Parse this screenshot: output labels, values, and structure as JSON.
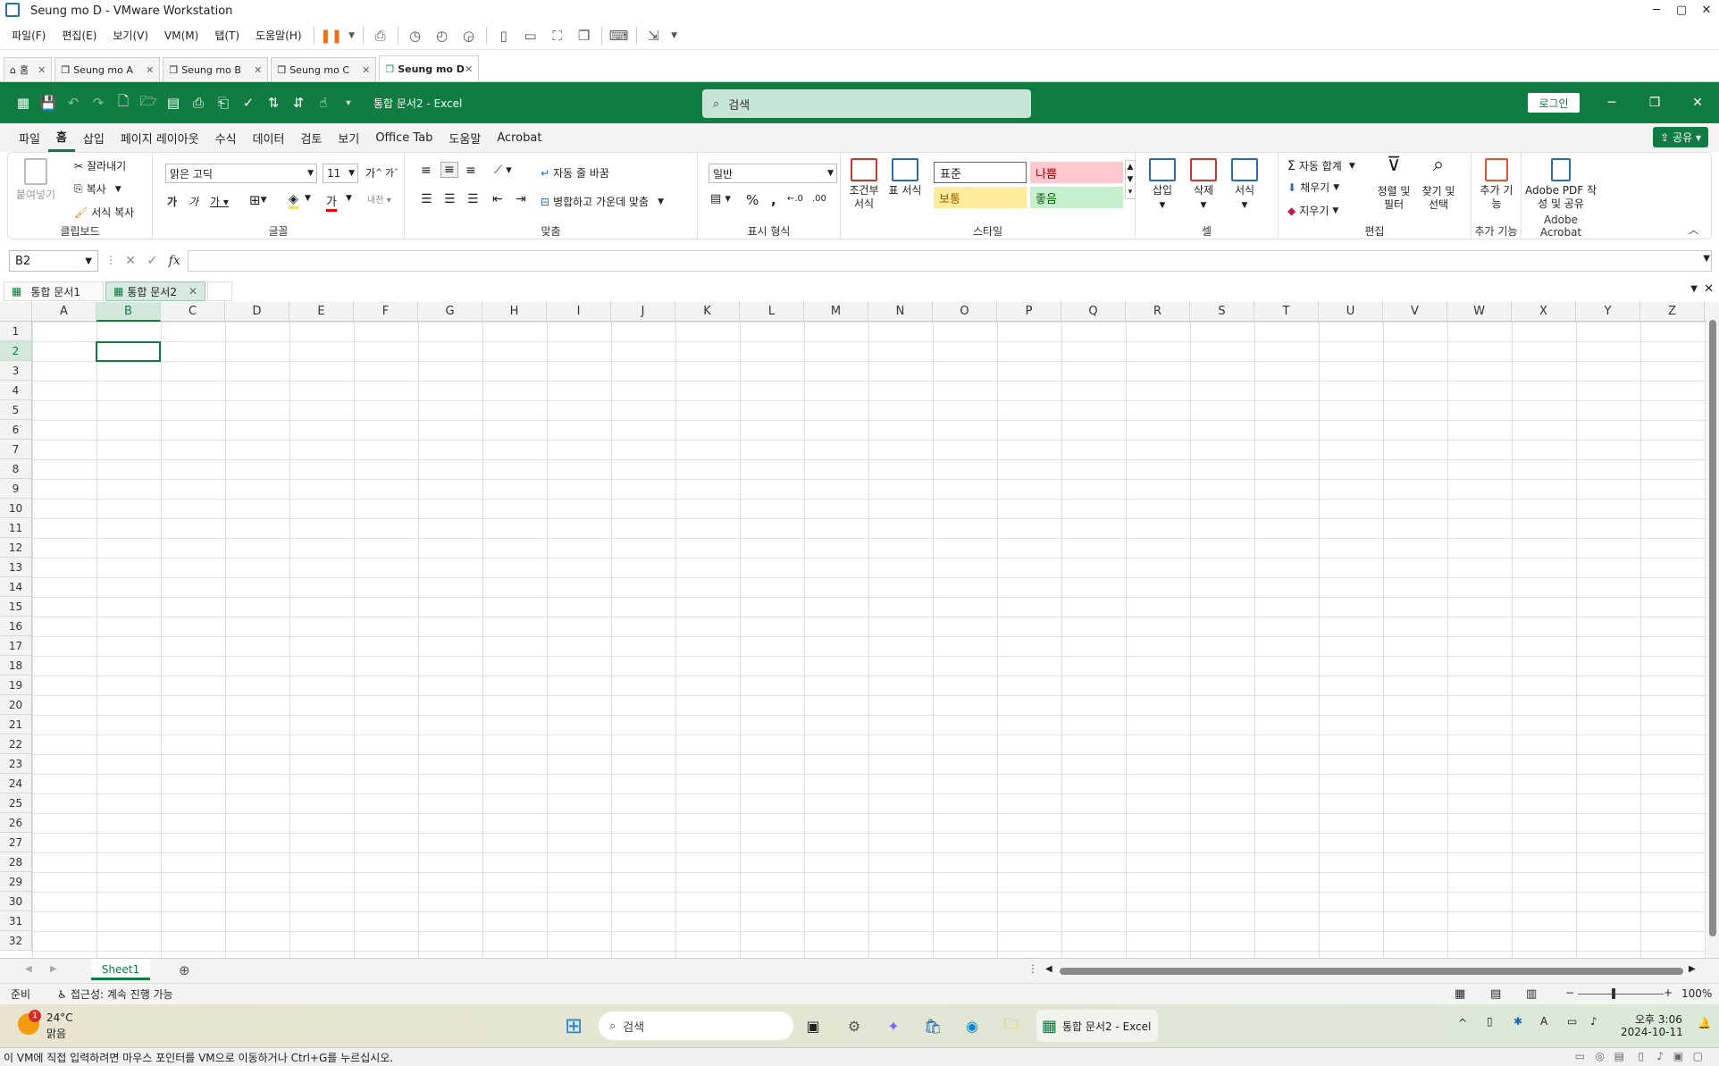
{
  "vm": {
    "title": "Seung mo D - VMware Workstation",
    "menu": [
      "파일(F)",
      "편집(E)",
      "보기(V)",
      "VM(M)",
      "탭(T)",
      "도움말(H)"
    ],
    "tabs": [
      {
        "label": "홈"
      },
      {
        "label": "Seung mo A"
      },
      {
        "label": "Seung mo B"
      },
      {
        "label": "Seung mo C"
      },
      {
        "label": "Seung mo D",
        "active": true
      }
    ],
    "status_message": "이 VM에 직접 입력하려면 마우스 포인터를 VM으로 이동하거나 Ctrl+G를 누르십시오."
  },
  "excel": {
    "title": "통합 문서2  -  Excel",
    "search_placeholder": "검색",
    "login": "로그인",
    "share": "공유",
    "ribbon_tabs": [
      "파일",
      "홈",
      "삽입",
      "페이지 레이아웃",
      "수식",
      "데이터",
      "검토",
      "보기",
      "Office Tab",
      "도움말",
      "Acrobat"
    ],
    "active_ribbon_tab": "홈",
    "clipboard": {
      "paste": "붙여넣기",
      "cut": "잘라내기",
      "copy": "복사",
      "format_painter": "서식 복사",
      "label": "클립보드"
    },
    "font": {
      "name": "맑은 고딕",
      "size": "11",
      "label": "글꼴"
    },
    "alignment": {
      "wrap": "자동 줄 바꿈",
      "merge": "병합하고 가운데 맞춤",
      "label": "맞춤"
    },
    "number": {
      "format": "일반",
      "label": "표시 형식"
    },
    "styles": {
      "conditional": "조건부 서식",
      "table": "표 서식",
      "normal": "표준",
      "bad": "나쁨",
      "neutral": "보통",
      "good": "좋음",
      "label": "스타일"
    },
    "cells": {
      "insert": "삽입",
      "delete": "삭제",
      "format": "서식",
      "label": "셀"
    },
    "editing": {
      "autosum": "자동 합계",
      "fill": "채우기",
      "clear": "지우기",
      "sort": "정렬 및 필터",
      "find": "찾기 및 선택",
      "label": "편집"
    },
    "addins": {
      "btn": "추가 기능",
      "label": "추가 기능"
    },
    "acrobat": {
      "btn": "Adobe PDF 작성 및 공유",
      "label": "Adobe Acrobat"
    },
    "name_box": "B2",
    "fx": "fx",
    "doc_tabs": [
      {
        "label": "통합 문서1"
      },
      {
        "label": "통합 문서2",
        "active": true
      }
    ],
    "columns": [
      "A",
      "B",
      "C",
      "D",
      "E",
      "F",
      "G",
      "H",
      "I",
      "J",
      "K",
      "L",
      "M",
      "N",
      "O",
      "P",
      "Q",
      "R",
      "S",
      "T",
      "U",
      "V",
      "W",
      "X",
      "Y",
      "Z"
    ],
    "rows": [
      "1",
      "2",
      "3",
      "4",
      "5",
      "6",
      "7",
      "8",
      "9",
      "10",
      "11",
      "12",
      "13",
      "14",
      "15",
      "16",
      "17",
      "18",
      "19",
      "20",
      "21",
      "22",
      "23",
      "24",
      "25",
      "26",
      "27",
      "28",
      "29",
      "30",
      "31",
      "32"
    ],
    "selected_col": "B",
    "selected_row": "2",
    "sheet": "Sheet1",
    "status_ready": "준비",
    "accessibility": "접근성: 계속 진행 가능",
    "zoom": "100%"
  },
  "taskbar": {
    "weather_temp": "24°C",
    "weather_desc": "맑음",
    "weather_badge": "1",
    "search": "검색",
    "excel_item": "통합 문서2 - Excel",
    "time": "오후 3:06",
    "date": "2024-10-11"
  },
  "colors": {
    "excel_green": "#107c41",
    "bad_bg": "#ffc7ce",
    "neutral_bg": "#ffeb9c",
    "good_bg": "#c6efce"
  }
}
